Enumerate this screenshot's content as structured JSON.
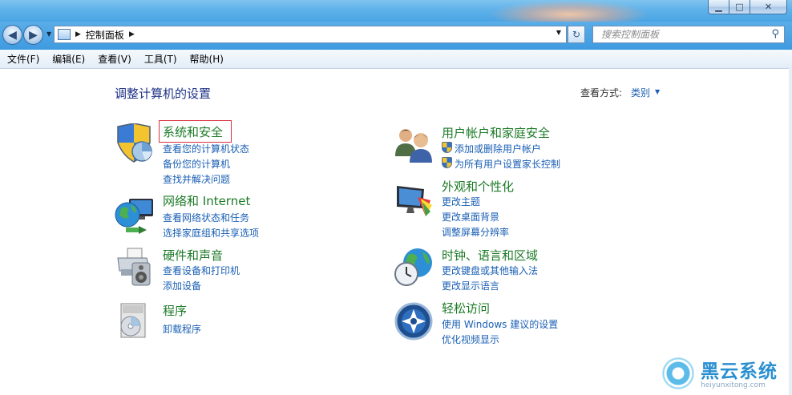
{
  "window": {
    "min_glyph": "▁",
    "max_glyph": "□",
    "close_glyph": "✕"
  },
  "nav": {
    "back_glyph": "◀",
    "forward_glyph": "▶",
    "breadcrumb": "控制面板",
    "search_placeholder": "搜索控制面板"
  },
  "menu": [
    "文件(F)",
    "编辑(E)",
    "查看(V)",
    "工具(T)",
    "帮助(H)"
  ],
  "content": {
    "heading": "调整计算机的设置",
    "view_by_label": "查看方式:",
    "view_by_value": "类别"
  },
  "categories": {
    "system": {
      "title": "系统和安全",
      "links": [
        "查看您的计算机状态",
        "备份您的计算机",
        "查找并解决问题"
      ],
      "icon": "shield-icon"
    },
    "network": {
      "title": "网络和 Internet",
      "links": [
        "查看网络状态和任务",
        "选择家庭组和共享选项"
      ],
      "icon": "network-globe-icon"
    },
    "hardware": {
      "title": "硬件和声音",
      "links": [
        "查看设备和打印机",
        "添加设备"
      ],
      "icon": "printer-speaker-icon"
    },
    "programs": {
      "title": "程序",
      "links": [
        "卸载程序"
      ],
      "icon": "programs-disc-icon"
    },
    "users": {
      "title": "用户帐户和家庭安全",
      "links": [
        "添加或删除用户帐户",
        "为所有用户设置家长控制"
      ],
      "icon": "users-icon"
    },
    "appearance": {
      "title": "外观和个性化",
      "links": [
        "更改主题",
        "更改桌面背景",
        "调整屏幕分辨率"
      ],
      "icon": "monitor-palette-icon"
    },
    "clock": {
      "title": "时钟、语言和区域",
      "links": [
        "更改键盘或其他输入法",
        "更改显示语言"
      ],
      "icon": "globe-clock-icon"
    },
    "ease": {
      "title": "轻松访问",
      "links": [
        "使用 Windows 建议的设置",
        "优化视频显示"
      ],
      "icon": "ease-of-access-icon"
    }
  },
  "watermark": {
    "name": "黑云系统",
    "url": "heiyunxitong.com"
  }
}
